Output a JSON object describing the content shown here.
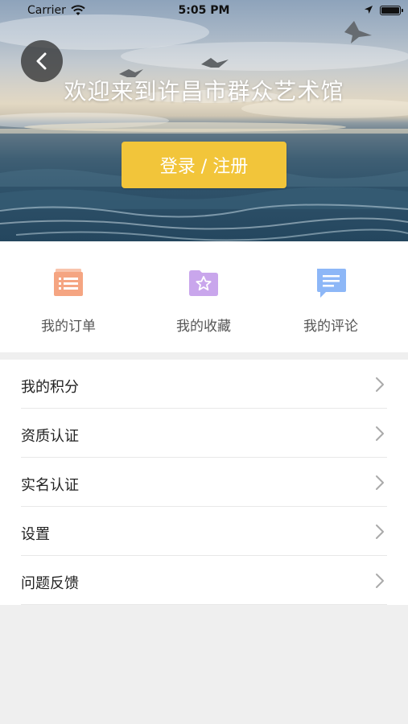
{
  "status_bar": {
    "carrier": "Carrier",
    "time": "5:05 PM",
    "icons": [
      "wifi-icon",
      "location-arrow-icon",
      "battery-icon"
    ]
  },
  "hero": {
    "welcome_text": "欢迎来到许昌市群众艺术馆",
    "login_button_label": "登录 / 注册",
    "back_icon": "chevron-left-icon"
  },
  "quick_actions": [
    {
      "label": "我的订单",
      "icon": "order-list-icon",
      "color": "#f5a582"
    },
    {
      "label": "我的收藏",
      "icon": "favorite-star-folder-icon",
      "color": "#c9a6ec"
    },
    {
      "label": "我的评论",
      "icon": "comment-bubble-icon",
      "color": "#8db7f7"
    }
  ],
  "menu": [
    {
      "label": "我的积分"
    },
    {
      "label": "资质认证"
    },
    {
      "label": "实名认证"
    },
    {
      "label": "设置"
    },
    {
      "label": "问题反馈"
    }
  ],
  "colors": {
    "accent": "#f2c53a",
    "background": "#efefef"
  }
}
